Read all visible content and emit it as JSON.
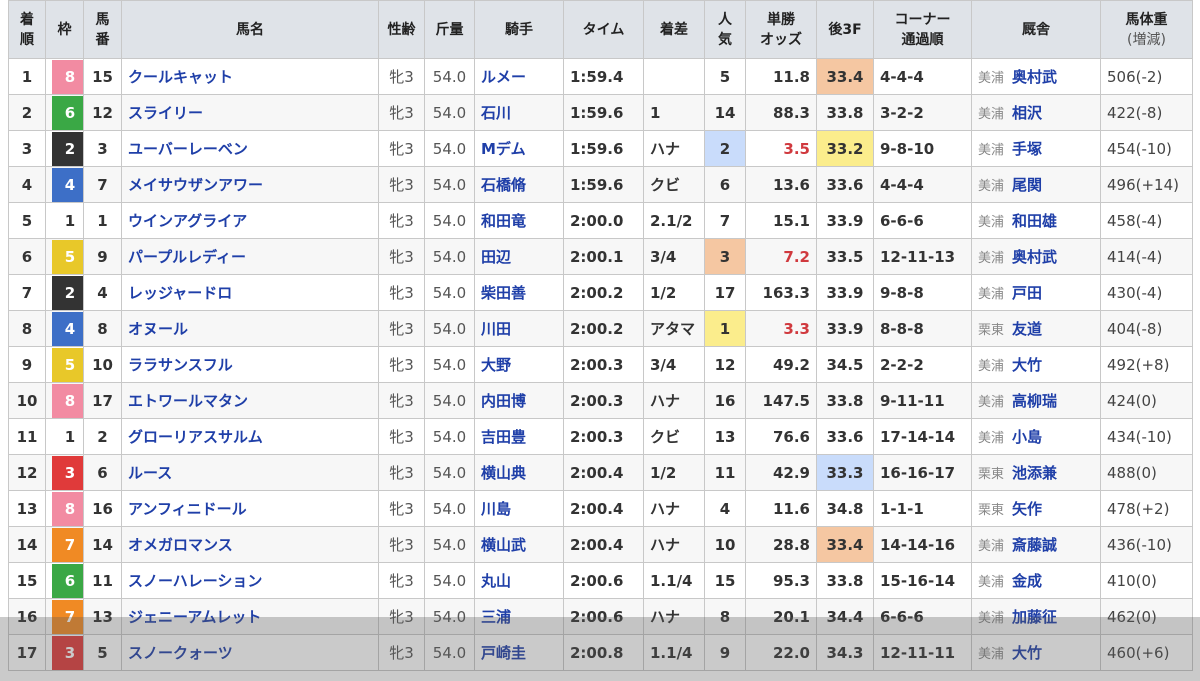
{
  "headers": {
    "rank": [
      "着",
      "順"
    ],
    "waku": "枠",
    "num": [
      "馬",
      "番"
    ],
    "name": "馬名",
    "sex_age": "性齢",
    "weight": "斤量",
    "jockey": "騎手",
    "time": "タイム",
    "margin": "着差",
    "popularity": [
      "人",
      "気"
    ],
    "odds": [
      "単勝",
      "オッズ"
    ],
    "last3f": "後3F",
    "corner": [
      "コーナー",
      "通過順"
    ],
    "trainer": "厩舎",
    "body_weight": [
      "馬体重",
      "(増減)"
    ]
  },
  "colors": {
    "waku": {
      "1": {
        "bg": "#ffffff",
        "fg": "#333333"
      },
      "2": {
        "bg": "#333333",
        "fg": "#ffffff"
      },
      "3": {
        "bg": "#e03a3a",
        "fg": "#ffffff"
      },
      "4": {
        "bg": "#3d6fc7",
        "fg": "#ffffff"
      },
      "5": {
        "bg": "#e8c829",
        "fg": "#ffffff"
      },
      "6": {
        "bg": "#3aa845",
        "fg": "#ffffff"
      },
      "7": {
        "bg": "#f08a24",
        "fg": "#ffffff"
      },
      "8": {
        "bg": "#f28ba2",
        "fg": "#ffffff"
      }
    },
    "pop_highlight": {
      "1": "#fbed8c",
      "2": "#c9dcfb",
      "3": "#f5c7a2"
    },
    "last3f_highlight": {
      "1": "#fbed8c",
      "2": "#c9dcfb",
      "3": "#f5c7a2"
    },
    "odds_red": "#d0393e"
  },
  "rows": [
    {
      "rank": "1",
      "waku": "8",
      "num": "15",
      "name": "クールキャット",
      "sex_age": "牝3",
      "weight": "54.0",
      "jockey": "ルメー",
      "time": "1:59.4",
      "margin": "",
      "popularity": "5",
      "odds": "11.8",
      "last3f": "33.4",
      "last3f_rank": "3",
      "corner": "4-4-4",
      "stable": "美浦",
      "trainer": "奥村武",
      "body_weight": "506(-2)"
    },
    {
      "rank": "2",
      "waku": "6",
      "num": "12",
      "name": "スライリー",
      "sex_age": "牝3",
      "weight": "54.0",
      "jockey": "石川",
      "time": "1:59.6",
      "margin": "1",
      "popularity": "14",
      "odds": "88.3",
      "last3f": "33.8",
      "last3f_rank": "",
      "corner": "3-2-2",
      "stable": "美浦",
      "trainer": "相沢",
      "body_weight": "422(-8)"
    },
    {
      "rank": "3",
      "waku": "2",
      "num": "3",
      "name": "ユーバーレーベン",
      "sex_age": "牝3",
      "weight": "54.0",
      "jockey": "Mデム",
      "time": "1:59.6",
      "margin": "ハナ",
      "popularity": "2",
      "odds": "3.5",
      "last3f": "33.2",
      "last3f_rank": "1",
      "corner": "9-8-10",
      "stable": "美浦",
      "trainer": "手塚",
      "body_weight": "454(-10)"
    },
    {
      "rank": "4",
      "waku": "4",
      "num": "7",
      "name": "メイサウザンアワー",
      "sex_age": "牝3",
      "weight": "54.0",
      "jockey": "石橋脩",
      "time": "1:59.6",
      "margin": "クビ",
      "popularity": "6",
      "odds": "13.6",
      "last3f": "33.6",
      "last3f_rank": "",
      "corner": "4-4-4",
      "stable": "美浦",
      "trainer": "尾関",
      "body_weight": "496(+14)"
    },
    {
      "rank": "5",
      "waku": "1",
      "num": "1",
      "name": "ウインアグライア",
      "sex_age": "牝3",
      "weight": "54.0",
      "jockey": "和田竜",
      "time": "2:00.0",
      "margin": "2.1/2",
      "popularity": "7",
      "odds": "15.1",
      "last3f": "33.9",
      "last3f_rank": "",
      "corner": "6-6-6",
      "stable": "美浦",
      "trainer": "和田雄",
      "body_weight": "458(-4)"
    },
    {
      "rank": "6",
      "waku": "5",
      "num": "9",
      "name": "パープルレディー",
      "sex_age": "牝3",
      "weight": "54.0",
      "jockey": "田辺",
      "time": "2:00.1",
      "margin": "3/4",
      "popularity": "3",
      "odds": "7.2",
      "last3f": "33.5",
      "last3f_rank": "",
      "corner": "12-11-13",
      "stable": "美浦",
      "trainer": "奥村武",
      "body_weight": "414(-4)"
    },
    {
      "rank": "7",
      "waku": "2",
      "num": "4",
      "name": "レッジャードロ",
      "sex_age": "牝3",
      "weight": "54.0",
      "jockey": "柴田善",
      "time": "2:00.2",
      "margin": "1/2",
      "popularity": "17",
      "odds": "163.3",
      "last3f": "33.9",
      "last3f_rank": "",
      "corner": "9-8-8",
      "stable": "美浦",
      "trainer": "戸田",
      "body_weight": "430(-4)"
    },
    {
      "rank": "8",
      "waku": "4",
      "num": "8",
      "name": "オヌール",
      "sex_age": "牝3",
      "weight": "54.0",
      "jockey": "川田",
      "time": "2:00.2",
      "margin": "アタマ",
      "popularity": "1",
      "odds": "3.3",
      "last3f": "33.9",
      "last3f_rank": "",
      "corner": "8-8-8",
      "stable": "栗東",
      "trainer": "友道",
      "body_weight": "404(-8)"
    },
    {
      "rank": "9",
      "waku": "5",
      "num": "10",
      "name": "ララサンスフル",
      "sex_age": "牝3",
      "weight": "54.0",
      "jockey": "大野",
      "time": "2:00.3",
      "margin": "3/4",
      "popularity": "12",
      "odds": "49.2",
      "last3f": "34.5",
      "last3f_rank": "",
      "corner": "2-2-2",
      "stable": "美浦",
      "trainer": "大竹",
      "body_weight": "492(+8)"
    },
    {
      "rank": "10",
      "waku": "8",
      "num": "17",
      "name": "エトワールマタン",
      "sex_age": "牝3",
      "weight": "54.0",
      "jockey": "内田博",
      "time": "2:00.3",
      "margin": "ハナ",
      "popularity": "16",
      "odds": "147.5",
      "last3f": "33.8",
      "last3f_rank": "",
      "corner": "9-11-11",
      "stable": "美浦",
      "trainer": "高柳瑞",
      "body_weight": "424(0)"
    },
    {
      "rank": "11",
      "waku": "1",
      "num": "2",
      "name": "グローリアスサルム",
      "sex_age": "牝3",
      "weight": "54.0",
      "jockey": "吉田豊",
      "time": "2:00.3",
      "margin": "クビ",
      "popularity": "13",
      "odds": "76.6",
      "last3f": "33.6",
      "last3f_rank": "",
      "corner": "17-14-14",
      "stable": "美浦",
      "trainer": "小島",
      "body_weight": "434(-10)"
    },
    {
      "rank": "12",
      "waku": "3",
      "num": "6",
      "name": "ルース",
      "sex_age": "牝3",
      "weight": "54.0",
      "jockey": "横山典",
      "time": "2:00.4",
      "margin": "1/2",
      "popularity": "11",
      "odds": "42.9",
      "last3f": "33.3",
      "last3f_rank": "2",
      "corner": "16-16-17",
      "stable": "栗東",
      "trainer": "池添兼",
      "body_weight": "488(0)"
    },
    {
      "rank": "13",
      "waku": "8",
      "num": "16",
      "name": "アンフィニドール",
      "sex_age": "牝3",
      "weight": "54.0",
      "jockey": "川島",
      "time": "2:00.4",
      "margin": "ハナ",
      "popularity": "4",
      "odds": "11.6",
      "last3f": "34.8",
      "last3f_rank": "",
      "corner": "1-1-1",
      "stable": "栗東",
      "trainer": "矢作",
      "body_weight": "478(+2)"
    },
    {
      "rank": "14",
      "waku": "7",
      "num": "14",
      "name": "オメガロマンス",
      "sex_age": "牝3",
      "weight": "54.0",
      "jockey": "横山武",
      "time": "2:00.4",
      "margin": "ハナ",
      "popularity": "10",
      "odds": "28.8",
      "last3f": "33.4",
      "last3f_rank": "3",
      "corner": "14-14-16",
      "stable": "美浦",
      "trainer": "斎藤誠",
      "body_weight": "436(-10)"
    },
    {
      "rank": "15",
      "waku": "6",
      "num": "11",
      "name": "スノーハレーション",
      "sex_age": "牝3",
      "weight": "54.0",
      "jockey": "丸山",
      "time": "2:00.6",
      "margin": "1.1/4",
      "popularity": "15",
      "odds": "95.3",
      "last3f": "33.8",
      "last3f_rank": "",
      "corner": "15-16-14",
      "stable": "美浦",
      "trainer": "金成",
      "body_weight": "410(0)"
    },
    {
      "rank": "16",
      "waku": "7",
      "num": "13",
      "name": "ジェニーアムレット",
      "sex_age": "牝3",
      "weight": "54.0",
      "jockey": "三浦",
      "time": "2:00.6",
      "margin": "ハナ",
      "popularity": "8",
      "odds": "20.1",
      "last3f": "34.4",
      "last3f_rank": "",
      "corner": "6-6-6",
      "stable": "美浦",
      "trainer": "加藤征",
      "body_weight": "462(0)"
    },
    {
      "rank": "17",
      "waku": "3",
      "num": "5",
      "name": "スノークォーツ",
      "sex_age": "牝3",
      "weight": "54.0",
      "jockey": "戸崎圭",
      "time": "2:00.8",
      "margin": "1.1/4",
      "popularity": "9",
      "odds": "22.0",
      "last3f": "34.3",
      "last3f_rank": "",
      "corner": "12-11-11",
      "stable": "美浦",
      "trainer": "大竹",
      "body_weight": "460(+6)"
    }
  ]
}
